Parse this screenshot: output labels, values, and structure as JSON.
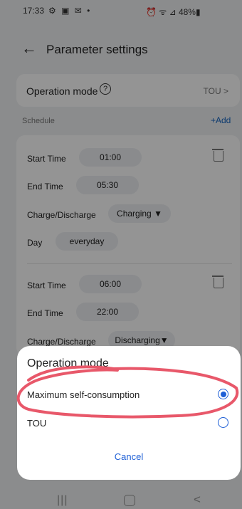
{
  "status_bar": {
    "time": "17:33",
    "left_icons": "⚙ ▣ ✉ •",
    "right_icons": "⏰ ᯤ ⊿ 48%▮"
  },
  "header": {
    "back_icon": "←",
    "title": "Parameter settings"
  },
  "operation_mode_row": {
    "label": "Operation mode",
    "help_icon": "?",
    "value": "TOU >"
  },
  "schedule": {
    "label": "Schedule",
    "add_label": "+Add",
    "entries": [
      {
        "start_label": "Start Time",
        "start": "01:00",
        "end_label": "End Time",
        "end": "05:30",
        "charge_label": "Charge/Discharge",
        "charge": "Charging ▼",
        "day_label": "Day",
        "day": "everyday"
      },
      {
        "start_label": "Start Time",
        "start": "06:00",
        "end_label": "End Time",
        "end": "22:00",
        "charge_label": "Charge/Discharge",
        "charge": "Discharging▼"
      }
    ]
  },
  "dialog": {
    "title": "Operation mode",
    "options": [
      {
        "label": "Maximum self-consumption",
        "selected": true
      },
      {
        "label": "TOU",
        "selected": false
      }
    ],
    "cancel": "Cancel"
  },
  "nav_bar": {
    "recent": "|||",
    "back": "<"
  },
  "colors": {
    "accent": "#1e5fd6",
    "annotation": "#e8586a"
  }
}
